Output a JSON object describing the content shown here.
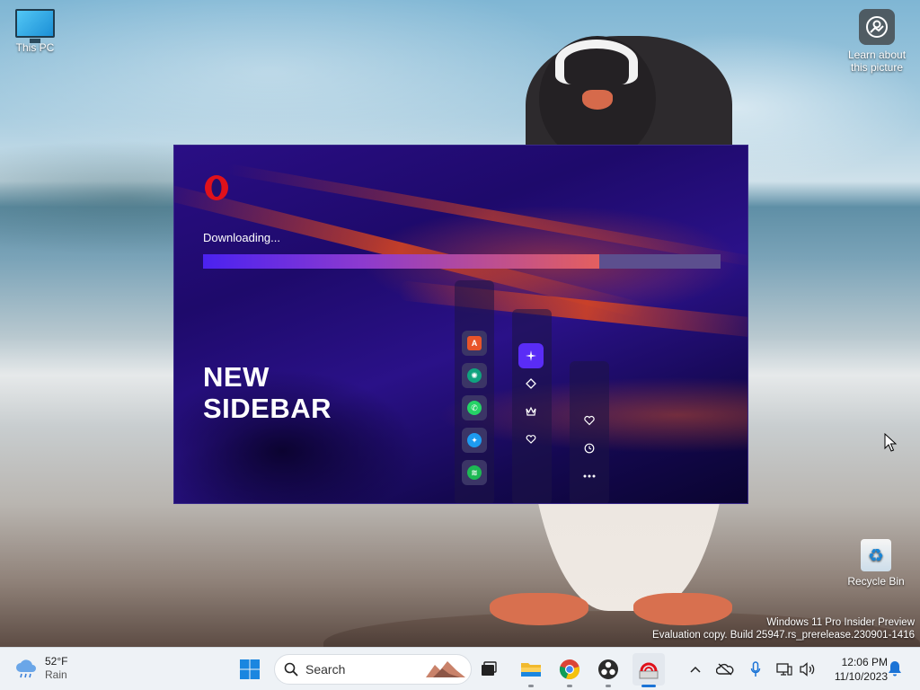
{
  "desktop": {
    "icons": [
      {
        "label": "This PC"
      },
      {
        "label": "Learn about this picture",
        "line1": "Learn about",
        "line2": "this picture"
      },
      {
        "label": "Recycle Bin"
      }
    ],
    "watermark": {
      "line1": "Windows 11 Pro Insider Preview",
      "line2": "Evaluation copy. Build 25947.rs_prerelease.230901-1416"
    }
  },
  "installer": {
    "status": "Downloading...",
    "progress": 0.765,
    "headline_line1": "NEW",
    "headline_line2": "SIDEBAR",
    "colors": {
      "accent": "#5a2cf6",
      "logo": "#e0111b",
      "progress_start": "#4b22f0",
      "progress_end": "#e45f5f"
    },
    "sidebar_apps": [
      {
        "icon": "aria-icon",
        "color": "#e8542a"
      },
      {
        "icon": "chatgpt-icon",
        "color": "#10a37f"
      },
      {
        "icon": "whatsapp-icon",
        "color": "#25d366"
      },
      {
        "icon": "twitter-icon",
        "color": "#1d9bf0"
      },
      {
        "icon": "spotify-icon",
        "color": "#1db954"
      }
    ],
    "sidebar_tools": [
      "sparkle-icon",
      "diamond-icon",
      "crown-icon",
      "heart-shield-icon"
    ],
    "sidebar_bottom": [
      "heart-icon",
      "history-icon",
      "more-icon"
    ]
  },
  "taskbar": {
    "weather": {
      "temp": "52°F",
      "condition": "Rain"
    },
    "search_placeholder": "Search",
    "apps": [
      "start-icon",
      "task-view-icon",
      "file-explorer-icon",
      "chrome-icon",
      "obs-icon",
      "opera-installer-icon"
    ],
    "tray_icons": [
      "chevron-up-icon",
      "onedrive-icon",
      "microphone-icon",
      "network-icon",
      "volume-icon"
    ],
    "clock": {
      "time": "12:06 PM",
      "date": "11/10/2023"
    }
  }
}
